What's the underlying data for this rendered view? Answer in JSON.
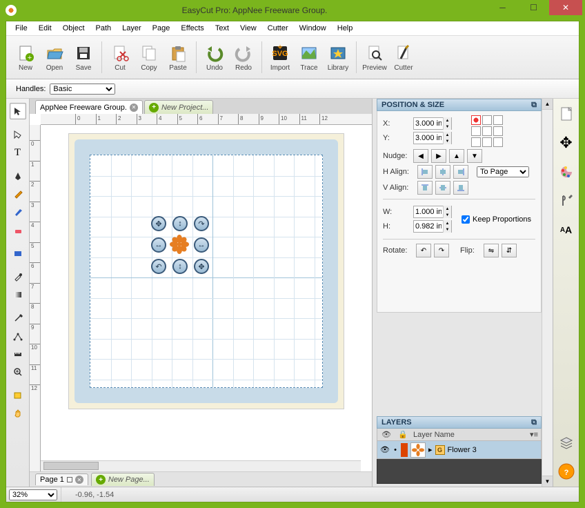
{
  "window": {
    "title": "EasyCut Pro: AppNee Freeware Group."
  },
  "menu": [
    "File",
    "Edit",
    "Object",
    "Path",
    "Layer",
    "Page",
    "Effects",
    "Text",
    "View",
    "Cutter",
    "Window",
    "Help"
  ],
  "toolbar": [
    {
      "id": "new",
      "label": "New"
    },
    {
      "id": "open",
      "label": "Open"
    },
    {
      "id": "save",
      "label": "Save"
    },
    {
      "sep": true
    },
    {
      "id": "cut",
      "label": "Cut"
    },
    {
      "id": "copy",
      "label": "Copy"
    },
    {
      "id": "paste",
      "label": "Paste"
    },
    {
      "sep": true
    },
    {
      "id": "undo",
      "label": "Undo"
    },
    {
      "id": "redo",
      "label": "Redo"
    },
    {
      "sep": true
    },
    {
      "id": "import",
      "label": "Import"
    },
    {
      "id": "trace",
      "label": "Trace"
    },
    {
      "id": "library",
      "label": "Library"
    },
    {
      "sep": true
    },
    {
      "id": "preview",
      "label": "Preview"
    },
    {
      "id": "cutter",
      "label": "Cutter"
    }
  ],
  "handles": {
    "label": "Handles:",
    "value": "Basic"
  },
  "doc_tabs": {
    "active": "AppNee Freeware Group.",
    "new": "New Project..."
  },
  "page_tabs": {
    "active": "Page 1",
    "new": "New Page..."
  },
  "position_size": {
    "title": "POSITION & SIZE",
    "x_label": "X:",
    "y_label": "Y:",
    "x": "3.000 in",
    "y": "3.000 in",
    "nudge_label": "Nudge:",
    "halign_label": "H Align:",
    "valign_label": "V Align:",
    "align_ref": "To Page",
    "w_label": "W:",
    "h_label": "H:",
    "w": "1.000 in",
    "h": "0.982 in",
    "keep_prop": "Keep Proportions",
    "rotate_label": "Rotate:",
    "flip_label": "Flip:"
  },
  "layers": {
    "title": "LAYERS",
    "col": "Layer Name",
    "item": "Flower 3"
  },
  "status": {
    "zoom": "32%",
    "coord": "-0.96, -1.54"
  },
  "ruler_h": [
    0,
    1,
    2,
    3,
    4,
    5,
    6,
    7,
    8,
    9,
    10,
    11,
    12
  ],
  "ruler_v": [
    0,
    1,
    2,
    3,
    4,
    5,
    6,
    7,
    8,
    9,
    10,
    11,
    12
  ]
}
